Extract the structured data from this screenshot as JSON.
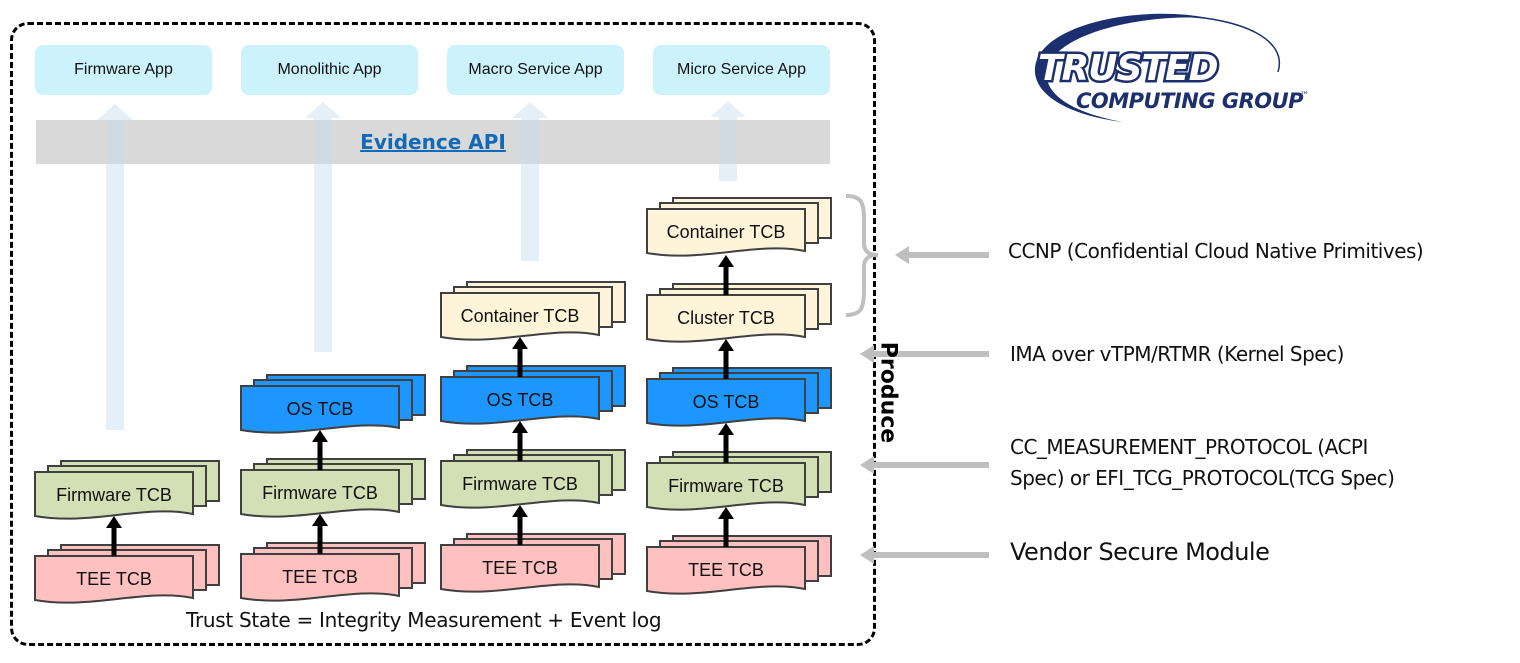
{
  "apps": [
    {
      "label": "Firmware App"
    },
    {
      "label": "Monolithic App"
    },
    {
      "label": "Macro Service App"
    },
    {
      "label": "Micro Service App"
    }
  ],
  "evidence_api": {
    "label": "Evidence API"
  },
  "columns": [
    {
      "layers": [
        {
          "label": "TEE TCB",
          "kind": "tee"
        },
        {
          "label": "Firmware TCB",
          "kind": "firmware"
        }
      ]
    },
    {
      "layers": [
        {
          "label": "TEE TCB",
          "kind": "tee"
        },
        {
          "label": "Firmware TCB",
          "kind": "firmware"
        },
        {
          "label": "OS TCB",
          "kind": "os"
        }
      ]
    },
    {
      "layers": [
        {
          "label": "TEE TCB",
          "kind": "tee"
        },
        {
          "label": "Firmware TCB",
          "kind": "firmware"
        },
        {
          "label": "OS TCB",
          "kind": "os"
        },
        {
          "label": "Container TCB",
          "kind": "container"
        }
      ]
    },
    {
      "layers": [
        {
          "label": "TEE TCB",
          "kind": "tee"
        },
        {
          "label": "Firmware TCB",
          "kind": "firmware"
        },
        {
          "label": "OS TCB",
          "kind": "os"
        },
        {
          "label": "Cluster TCB",
          "kind": "container"
        },
        {
          "label": "Container TCB",
          "kind": "container"
        }
      ]
    }
  ],
  "layer_colors": {
    "tee": "#ffc0c0",
    "firmware": "#d3e0b5",
    "os": "#1e96ff",
    "container": "#fdf4da",
    "app": "#ccf2fc",
    "api_bar": "#d9d9d9",
    "api_text": "#1169b8"
  },
  "caption": "Trust State = Integrity Measurement + Event log",
  "produce_label": "Produce",
  "side_labels": [
    {
      "text": "CCNP (Confidential Cloud Native Primitives)"
    },
    {
      "text": "IMA over vTPM/RTMR (Kernel Spec)"
    },
    {
      "text_line1": "CC_MEASUREMENT_PROTOCOL (ACPI",
      "text_line2": "Spec) or EFI_TCG_PROTOCOL(TCG Spec)"
    },
    {
      "text": "Vendor Secure Module"
    }
  ],
  "logo": {
    "line1": "TRUSTED",
    "line2": "COMPUTING GROUP",
    "tm": "™",
    "color": "#1c2f6e"
  }
}
